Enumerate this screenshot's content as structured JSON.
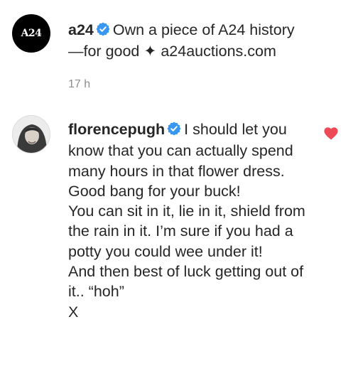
{
  "comments": [
    {
      "username": "a24",
      "verified": true,
      "avatar_text": "A24",
      "text": "Own a piece of A24 history —for good ✦ a24auctions.com",
      "timestamp": "17 h"
    },
    {
      "username": "florencepugh",
      "verified": true,
      "text_first": "I should let you know that you can actually spend many hours in that flower dress. Good bang for your buck!",
      "text_lines": [
        "You can sit in it, lie in it, shield from the rain in it. I’m sure if you had a potty you could wee under it!",
        "And then best of luck getting out of it.. “hoh”",
        "X"
      ],
      "liked": true
    }
  ],
  "colors": {
    "text": "#262626",
    "muted": "#8e8e8e",
    "verified": "#3897f0",
    "heart": "#ed4956"
  }
}
